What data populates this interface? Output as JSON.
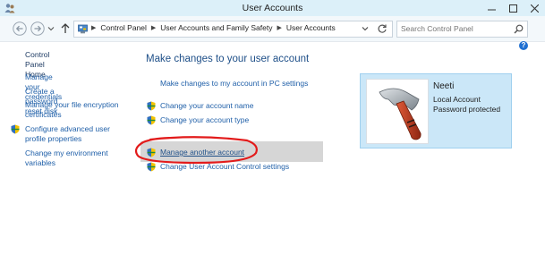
{
  "window": {
    "title": "User Accounts"
  },
  "address": {
    "breadcrumbs": [
      "Control Panel",
      "User Accounts and Family Safety",
      "User Accounts"
    ],
    "search_placeholder": "Search Control Panel"
  },
  "left_nav": {
    "home": "Control Panel Home",
    "links": [
      "Manage your credentials",
      "Create a password reset disk",
      "Manage your file encryption certificates",
      "Configure advanced user profile properties",
      "Change my environment variables"
    ]
  },
  "main": {
    "heading": "Make changes to your user account",
    "pc_settings_link": "Make changes to my account in PC settings",
    "links": [
      "Change your account name",
      "Change your account type",
      "Manage another account",
      "Change User Account Control settings"
    ]
  },
  "user": {
    "name": "Neeti",
    "account_type": "Local Account",
    "status": "Password protected"
  },
  "colors": {
    "annotation_circle": "#e21b1b",
    "link": "#1f5fa8",
    "card_bg": "#cbe7f8"
  }
}
